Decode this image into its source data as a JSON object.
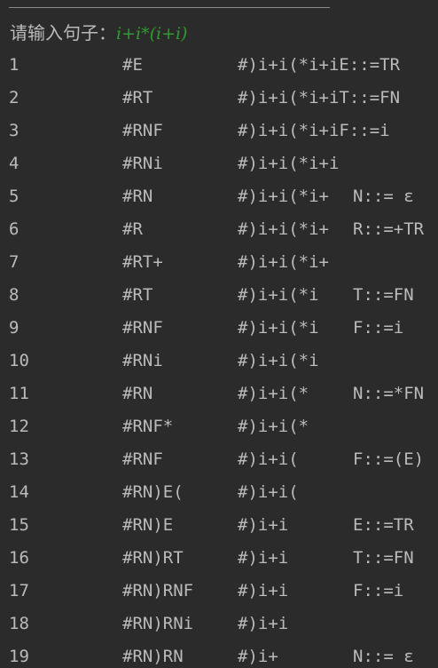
{
  "prompt": {
    "label": "请输入句子：",
    "input": "i+i*(i+i)"
  },
  "rows": [
    {
      "step": "1",
      "stack": "#E",
      "input": "#)i+i(*i+iE::=TR",
      "production": ""
    },
    {
      "step": "2",
      "stack": "#RT",
      "input": "#)i+i(*i+iT::=FN",
      "production": ""
    },
    {
      "step": "3",
      "stack": "#RNF",
      "input": "#)i+i(*i+iF::=i",
      "production": ""
    },
    {
      "step": "4",
      "stack": "#RNi",
      "input": "#)i+i(*i+i",
      "production": ""
    },
    {
      "step": "5",
      "stack": "#RN",
      "input": "#)i+i(*i+",
      "production": "N::= ε"
    },
    {
      "step": "6",
      "stack": "#R",
      "input": "#)i+i(*i+",
      "production": "R::=+TR"
    },
    {
      "step": "7",
      "stack": "#RT+",
      "input": "#)i+i(*i+",
      "production": ""
    },
    {
      "step": "8",
      "stack": "#RT",
      "input": "#)i+i(*i",
      "production": "T::=FN"
    },
    {
      "step": "9",
      "stack": "#RNF",
      "input": "#)i+i(*i",
      "production": "F::=i"
    },
    {
      "step": "10",
      "stack": "#RNi",
      "input": "#)i+i(*i",
      "production": ""
    },
    {
      "step": "11",
      "stack": "#RN",
      "input": "#)i+i(*",
      "production": "N::=*FN"
    },
    {
      "step": "12",
      "stack": "#RNF*",
      "input": "#)i+i(*",
      "production": ""
    },
    {
      "step": "13",
      "stack": "#RNF",
      "input": "#)i+i(",
      "production": "F::=(E)"
    },
    {
      "step": "14",
      "stack": "#RN)E(",
      "input": "#)i+i(",
      "production": ""
    },
    {
      "step": "15",
      "stack": "#RN)E",
      "input": "#)i+i",
      "production": "E::=TR"
    },
    {
      "step": "16",
      "stack": "#RN)RT",
      "input": "#)i+i",
      "production": "T::=FN"
    },
    {
      "step": "17",
      "stack": "#RN)RNF",
      "input": "#)i+i",
      "production": "F::=i"
    },
    {
      "step": "18",
      "stack": "#RN)RNi",
      "input": "#)i+i",
      "production": ""
    },
    {
      "step": "19",
      "stack": "#RN)RN",
      "input": "#)i+",
      "production": "N::= ε"
    }
  ]
}
